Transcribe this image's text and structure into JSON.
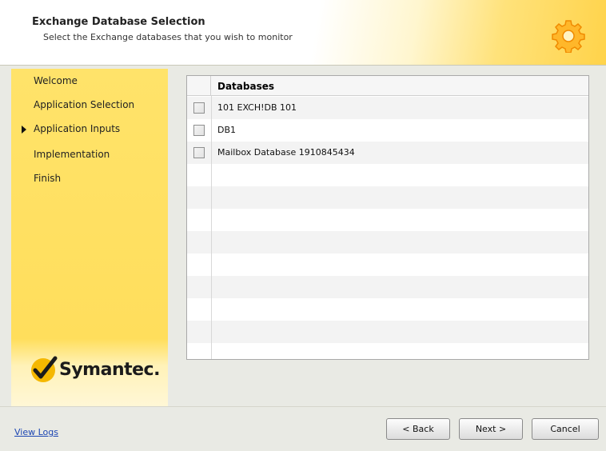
{
  "header": {
    "title": "Exchange Database Selection",
    "subtitle": "Select the Exchange databases that you wish to monitor",
    "icon": "gear-icon"
  },
  "sidebar": {
    "items": [
      {
        "label": "Welcome",
        "current": false
      },
      {
        "label": "Application Selection",
        "current": false
      },
      {
        "label": "Application Inputs",
        "current": true
      },
      {
        "label": "Implementation",
        "current": false
      },
      {
        "label": "Finish",
        "current": false
      }
    ],
    "logo": "Symantec."
  },
  "grid": {
    "column_header": "Databases",
    "rows": [
      {
        "name": "101 EXCH!DB 101",
        "checked": false
      },
      {
        "name": "DB1",
        "checked": false
      },
      {
        "name": "Mailbox Database 1910845434",
        "checked": false
      }
    ]
  },
  "footer": {
    "view_logs": "View Logs",
    "back": "< Back",
    "next": "Next >",
    "cancel": "Cancel"
  },
  "colors": {
    "sidebar": "#ffde5c",
    "link": "#1c46b3",
    "logo_check": "#f5b800"
  }
}
